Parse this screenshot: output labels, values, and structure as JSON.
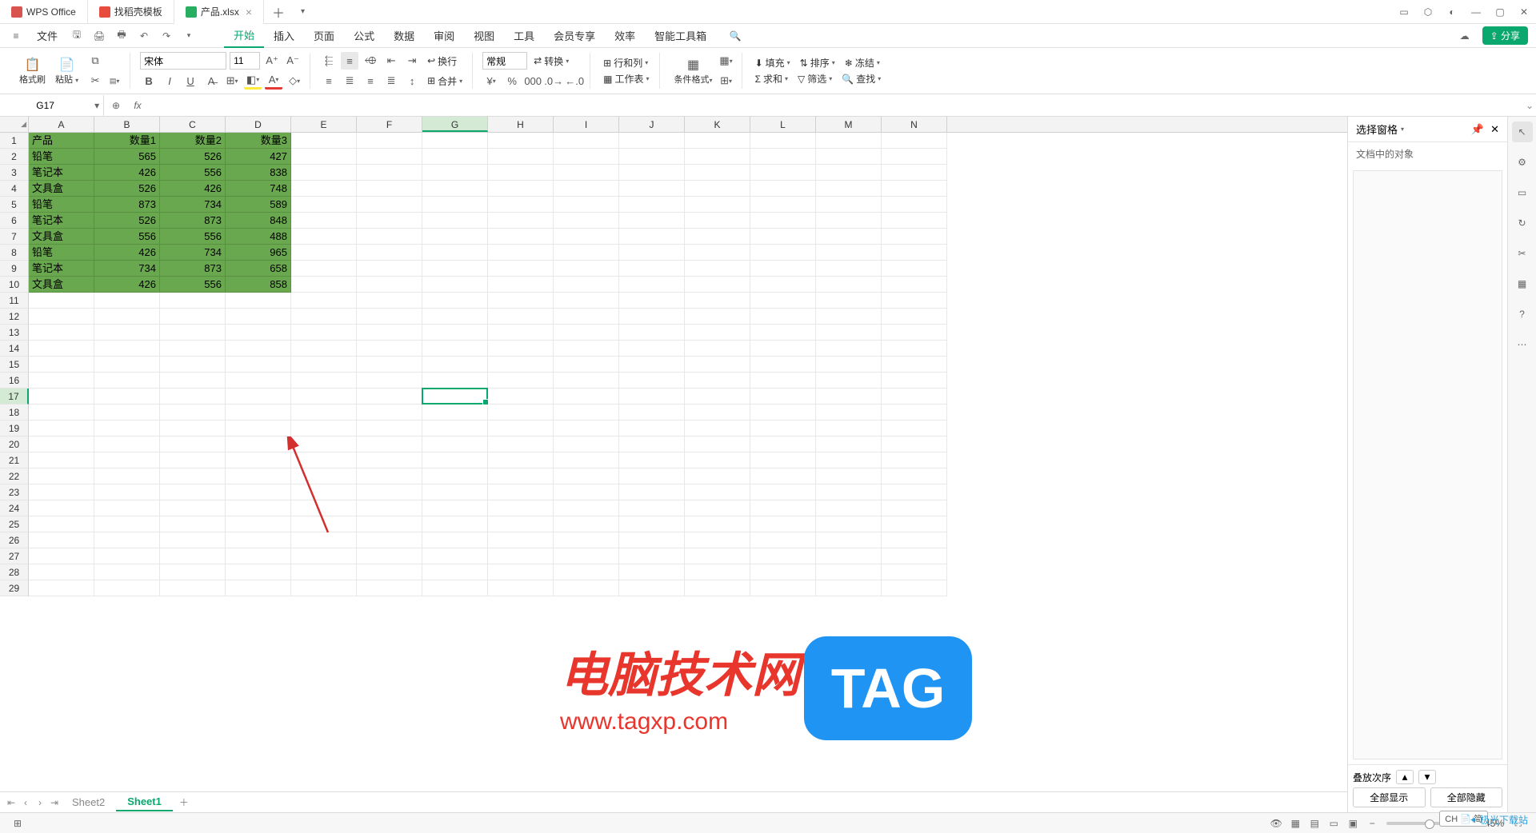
{
  "titlebar": {
    "tabs": [
      {
        "icon": "wps",
        "label": "WPS Office"
      },
      {
        "icon": "doc",
        "label": "找稻壳模板"
      },
      {
        "icon": "xls",
        "label": "产品.xlsx",
        "close": true,
        "active": true
      }
    ]
  },
  "menubar": {
    "file": "文件",
    "tabs": [
      "开始",
      "插入",
      "页面",
      "公式",
      "数据",
      "审阅",
      "视图",
      "工具",
      "会员专享",
      "效率",
      "智能工具箱"
    ],
    "active_tab": "开始",
    "share": "分享"
  },
  "ribbon": {
    "format_brush": "格式刷",
    "paste": "粘贴",
    "font_name": "宋体",
    "font_size": "11",
    "wrap": "换行",
    "merge": "合并",
    "number_format": "常规",
    "convert": "转换",
    "row_col": "行和列",
    "worksheet": "工作表",
    "cond_fmt": "条件格式",
    "fill": "填充",
    "sort": "排序",
    "freeze": "冻结",
    "sum": "求和",
    "filter": "筛选",
    "find": "查找"
  },
  "namebox": "G17",
  "side_panel": {
    "title": "选择窗格",
    "sub": "文档中的对象",
    "order": "叠放次序",
    "show_all": "全部显示",
    "hide_all": "全部隐藏"
  },
  "columns": [
    "A",
    "B",
    "C",
    "D",
    "E",
    "F",
    "G",
    "H",
    "I",
    "J",
    "K",
    "L",
    "M",
    "N"
  ],
  "row_count": 29,
  "selected": {
    "col": "G",
    "row": 17,
    "col_index": 6
  },
  "chart_data": {
    "type": "table",
    "headers": [
      "产品",
      "数量1",
      "数量2",
      "数量3"
    ],
    "rows": [
      [
        "铅笔",
        565,
        526,
        427
      ],
      [
        "笔记本",
        426,
        556,
        838
      ],
      [
        "文具盒",
        526,
        426,
        748
      ],
      [
        "铅笔",
        873,
        734,
        589
      ],
      [
        "笔记本",
        526,
        873,
        848
      ],
      [
        "文具盒",
        556,
        556,
        488
      ],
      [
        "铅笔",
        426,
        734,
        965
      ],
      [
        "笔记本",
        734,
        873,
        658
      ],
      [
        "文具盒",
        426,
        556,
        858
      ]
    ]
  },
  "sheets": {
    "inactive": "Sheet2",
    "active": "Sheet1"
  },
  "statusbar": {
    "zoom": "145%",
    "ch": "CH 📄 简"
  },
  "watermark": {
    "t1": "电脑技术网",
    "t2": "www.tagxp.com",
    "tag": "TAG",
    "jg": "极光下载站"
  }
}
